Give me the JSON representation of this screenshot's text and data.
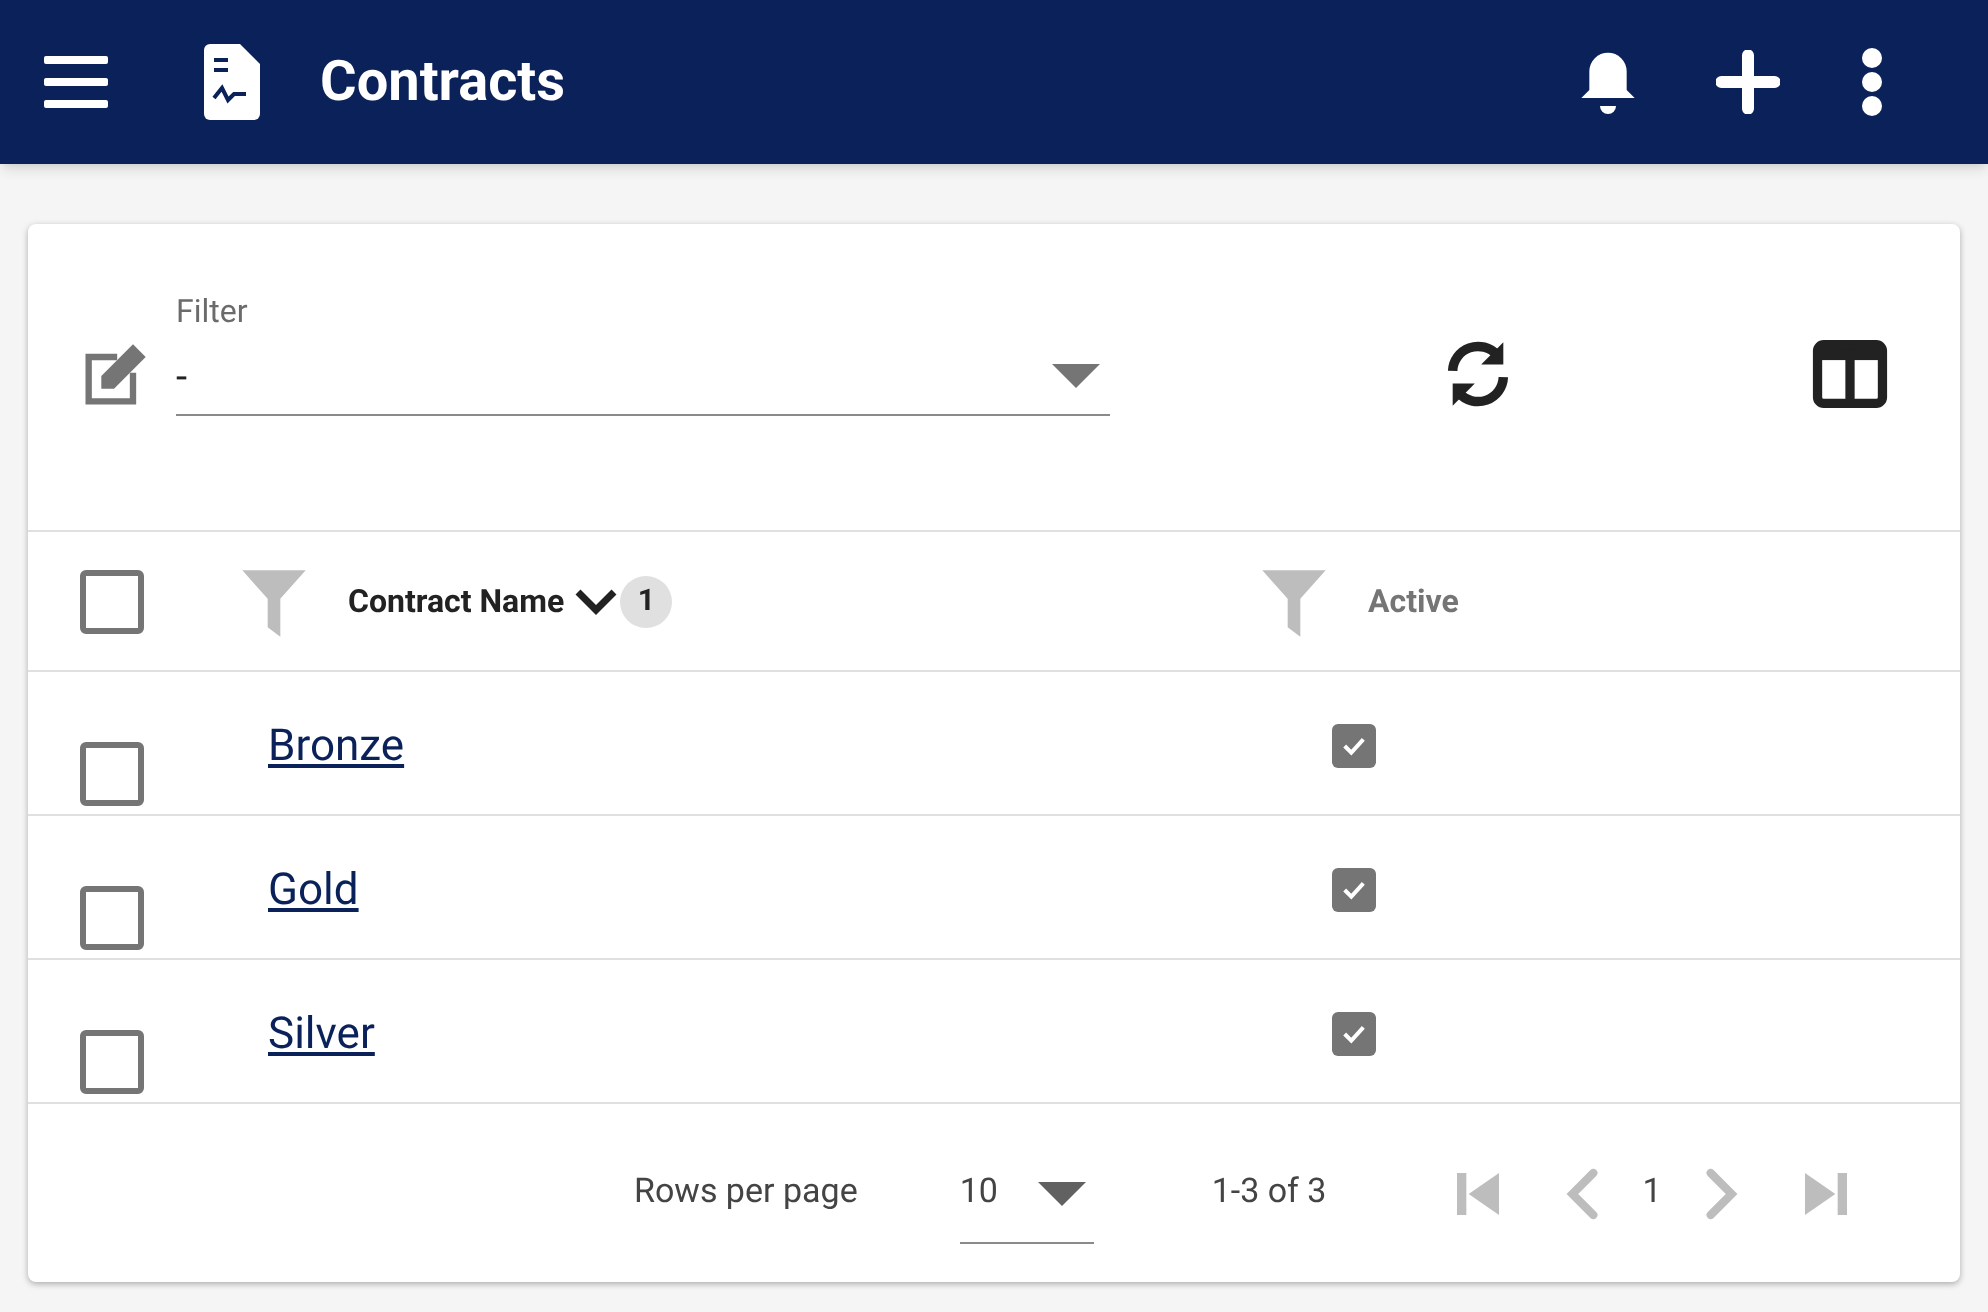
{
  "app_bar": {
    "title": "Contracts"
  },
  "filter": {
    "label": "Filter",
    "value": "-"
  },
  "table": {
    "select_all": {
      "checked": false
    },
    "columns": [
      {
        "label": "Contract Name",
        "sort_badge": "1",
        "sorted": true
      },
      {
        "label": "Active",
        "sorted": false
      }
    ],
    "rows": [
      {
        "selected": false,
        "name": "Bronze",
        "active": true
      },
      {
        "selected": false,
        "name": "Gold",
        "active": true
      },
      {
        "selected": false,
        "name": "Silver",
        "active": true
      }
    ]
  },
  "pagination": {
    "rows_per_page_label": "Rows per page",
    "rows_per_page": "10",
    "range": "1-3 of 3",
    "page": "1",
    "buttons": [
      {
        "kind": "first",
        "disabled": true
      },
      {
        "kind": "prev",
        "disabled": true
      },
      {
        "kind": "next",
        "disabled": true
      },
      {
        "kind": "last",
        "disabled": true
      }
    ]
  }
}
